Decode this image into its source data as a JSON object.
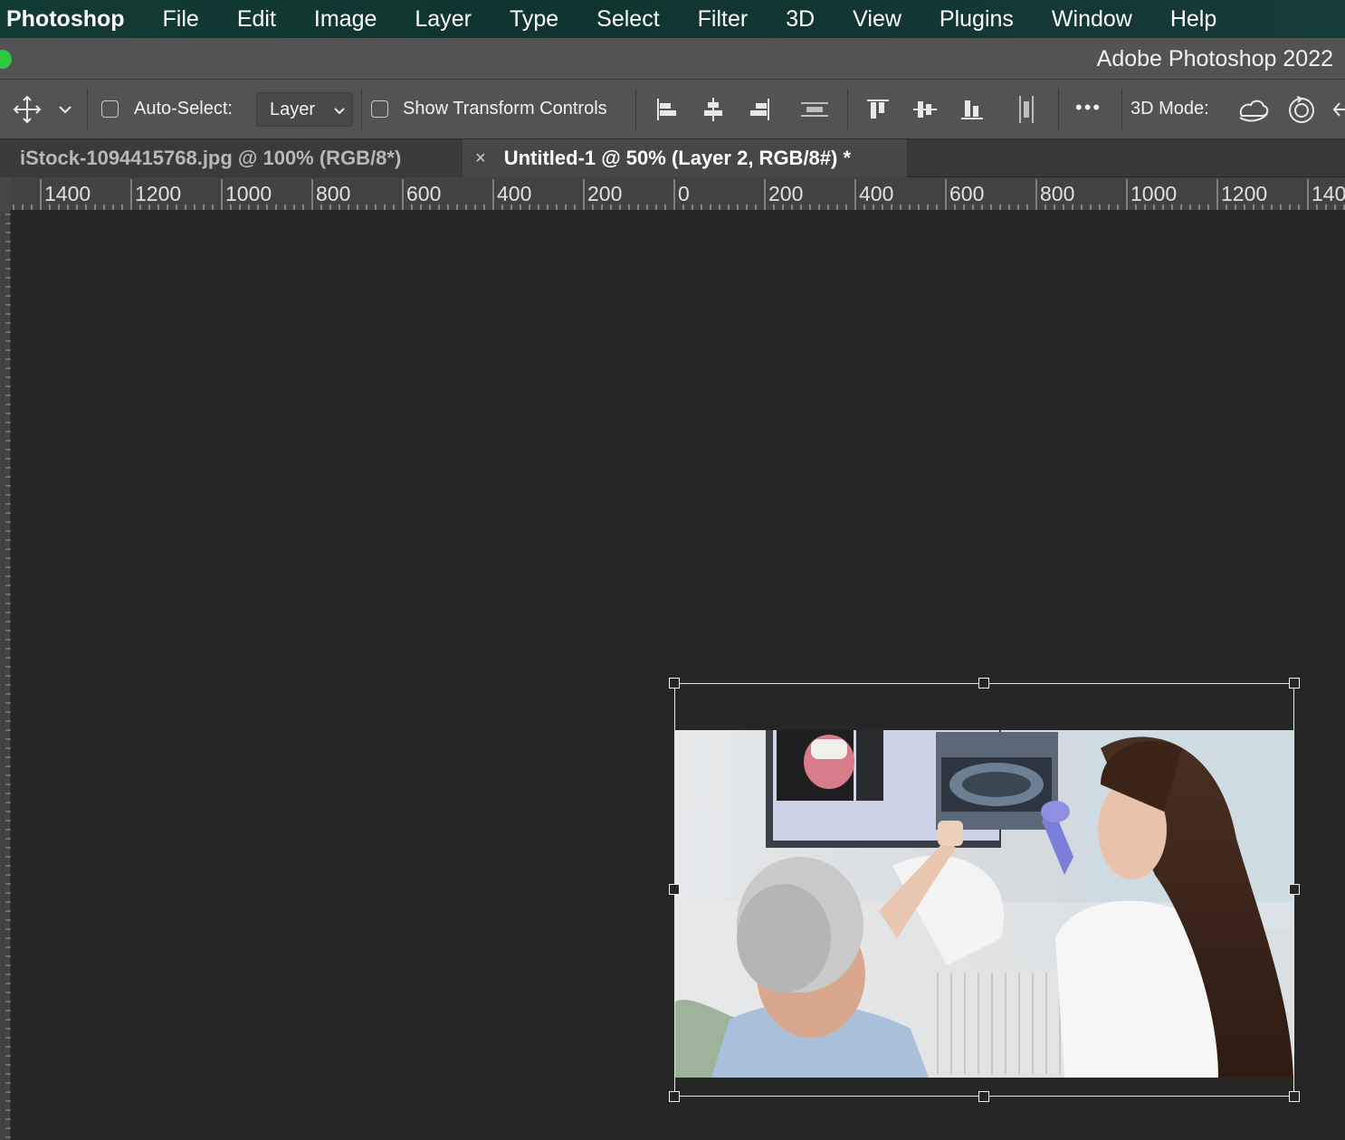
{
  "menubar": {
    "app_name": "Photoshop",
    "menus": [
      "File",
      "Edit",
      "Image",
      "Layer",
      "Type",
      "Select",
      "Filter",
      "3D",
      "View",
      "Plugins",
      "Window",
      "Help"
    ]
  },
  "window": {
    "title": "Adobe Photoshop 2022"
  },
  "options_bar": {
    "auto_select_label": "Auto-Select:",
    "auto_select_checked": false,
    "auto_select_target": "Layer",
    "show_transform_label": "Show Transform Controls",
    "show_transform_checked": false,
    "mode_label": "3D Mode:",
    "more_label": "•••",
    "icons": [
      "move-tool-icon",
      "align-left-icon",
      "align-horizontal-center-icon",
      "align-right-icon",
      "distribute-horizontal-icon",
      "align-top-icon",
      "align-vertical-center-icon",
      "align-bottom-icon",
      "distribute-vertical-icon",
      "more-options-icon",
      "3d-orbit-icon",
      "3d-roll-icon",
      "3d-pan-icon"
    ]
  },
  "tabs": [
    {
      "label": "iStock-1094415768.jpg @ 100% (RGB/8*)",
      "active": false
    },
    {
      "label": "Untitled-1 @ 50% (Layer 2, RGB/8#) *",
      "active": true,
      "close_glyph": "×"
    }
  ],
  "ruler": {
    "labels": [
      "1400",
      "1200",
      "1000",
      "800",
      "600",
      "400",
      "200",
      "0",
      "200",
      "400",
      "600",
      "800",
      "1000",
      "1200",
      "140"
    ]
  },
  "canvas": {
    "layer_content": "photo of dentist showing dental x-ray to senior patient",
    "transform_handles": 8
  },
  "colors": {
    "menubar_bg": "#123b34",
    "panel_bg": "#535353",
    "canvas_bg": "#262626",
    "traffic_green": "#2bc840"
  }
}
